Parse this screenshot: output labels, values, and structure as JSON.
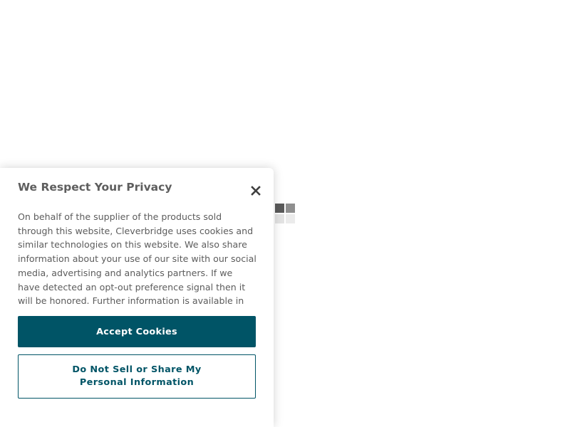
{
  "loader": {
    "icon": "loading-spinner-icon"
  },
  "cookie_banner": {
    "title": "We Respect Your Privacy",
    "close_icon": "close-icon",
    "body": "On behalf of the supplier of the products sold through this website, Cleverbridge uses cookies and similar technologies on this website. We also share information about your use of our site with our social media, advertising and analytics partners. If we have detected an opt-out preference signal then it will be honored. Further information is available in our",
    "accept_label": "Accept Cookies",
    "do_not_sell_label": "Do Not Sell or Share My Personal Information"
  },
  "colors": {
    "accent": "#005466",
    "text": "#5c5c5c",
    "title": "#5e5e5e"
  }
}
